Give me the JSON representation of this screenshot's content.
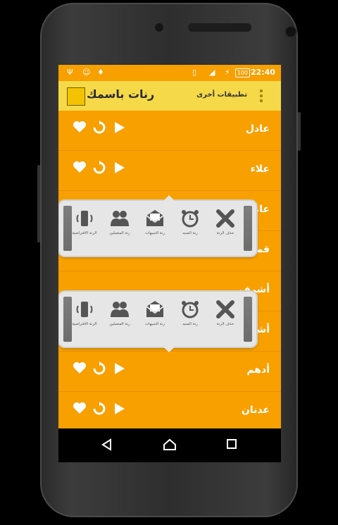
{
  "status": {
    "time": "22:40",
    "battery": "100"
  },
  "appbar": {
    "title": "رنات باسمك",
    "other_apps": "تطبيقات أخرى"
  },
  "rows": [
    {
      "name": "عادل"
    },
    {
      "name": "علاء"
    },
    {
      "name": "عامر"
    },
    {
      "name": "قمر"
    },
    {
      "name": "أشرف"
    },
    {
      "name": "أشواق"
    },
    {
      "name": "أدهم"
    },
    {
      "name": "عدنان"
    }
  ],
  "popup": {
    "items": [
      {
        "label": "حذف الرنة",
        "icon": "x-icon"
      },
      {
        "label": "رنة المنبه",
        "icon": "alarm-clock-icon"
      },
      {
        "label": "رنة التنبيهات",
        "icon": "mail-icon"
      },
      {
        "label": "رنة المتصلين",
        "icon": "contacts-icon"
      },
      {
        "label": "الرنة الافتراضية",
        "icon": "phone-icon"
      }
    ]
  },
  "colors": {
    "list_bg": "#f7a000",
    "appbar_bg": "#f5d949",
    "text": "#ffffff"
  }
}
